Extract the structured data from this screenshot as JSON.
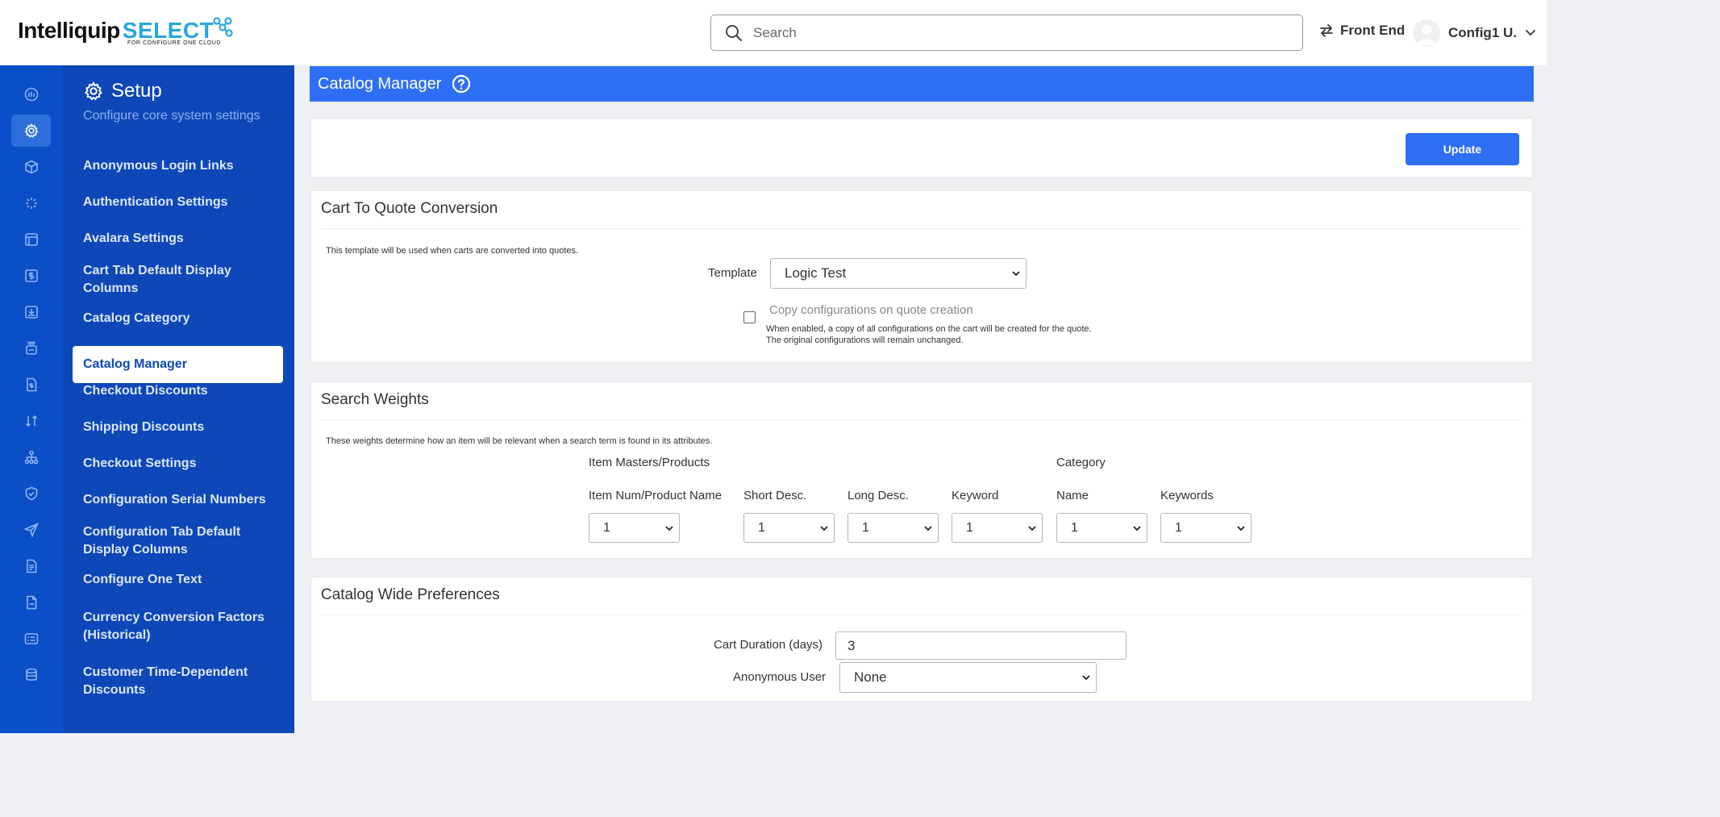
{
  "header": {
    "logo_main": "Intelliquip",
    "logo_select": "SELECT",
    "logo_sub": "FOR CONFIGURE ONE CLOUD",
    "search_placeholder": "Search",
    "front_end": "Front End",
    "user_name": "Config1 U."
  },
  "rail": {
    "icons": [
      "dashboard-icon",
      "gear-icon",
      "cube-icon",
      "loader-icon",
      "layout-icon",
      "dollar-icon",
      "download-icon",
      "stack-icon",
      "file-dollar-icon",
      "arrows-swap-icon",
      "hierarchy-icon",
      "shield-check-icon",
      "send-icon",
      "file-text-icon",
      "file-icon",
      "list-icon",
      "database-icon"
    ],
    "active_index": 1
  },
  "sidebar": {
    "title": "Setup",
    "subtitle": "Configure core system settings",
    "items": [
      {
        "label": "Anonymous Login Links"
      },
      {
        "label": "Authentication Settings"
      },
      {
        "label": "Avalara Settings"
      },
      {
        "label": "Cart Tab Default Display Columns"
      },
      {
        "label": "Catalog Category"
      },
      {
        "label": "Catalog Manager",
        "active": true
      },
      {
        "label": "Checkout Discounts"
      },
      {
        "label": "Shipping Discounts"
      },
      {
        "label": "Checkout Settings"
      },
      {
        "label": "Configuration Serial Numbers"
      },
      {
        "label": "Configuration Tab Default Display Columns"
      },
      {
        "label": "Configure One Text"
      },
      {
        "label": "Currency Conversion Factors (Historical)"
      },
      {
        "label": "Customer Time-Dependent Discounts"
      }
    ]
  },
  "page": {
    "title": "Catalog Manager",
    "update_label": "Update"
  },
  "cart_to_quote": {
    "title": "Cart To Quote Conversion",
    "note": "This template will be used when carts are converted into quotes.",
    "template_label": "Template",
    "template_value": "Logic Test",
    "copy_label": "Copy configurations on quote creation",
    "copy_checked": false,
    "copy_help_1": "When enabled, a copy of all configurations on the cart will be created for the quote.",
    "copy_help_2": "The original configurations will remain unchanged."
  },
  "search_weights": {
    "title": "Search Weights",
    "note": "These weights determine how an item will be relevant when a search term is found in its attributes.",
    "group_items": "Item Masters/Products",
    "group_category": "Category",
    "fields": [
      {
        "label": "Item Num/Product Name",
        "value": "1"
      },
      {
        "label": "Short Desc.",
        "value": "1"
      },
      {
        "label": "Long Desc.",
        "value": "1"
      },
      {
        "label": "Keyword",
        "value": "1"
      },
      {
        "label": "Name",
        "value": "1"
      },
      {
        "label": "Keywords",
        "value": "1"
      }
    ]
  },
  "catalog_prefs": {
    "title": "Catalog Wide Preferences",
    "cart_duration_label": "Cart Duration (days)",
    "cart_duration_value": "3",
    "anon_user_label": "Anonymous User",
    "anon_user_value": "None"
  },
  "colors": {
    "brand_blue": "#2e6ff6",
    "sidebar_blue": "#0d47b8",
    "rail_blue": "#0a4fc7",
    "logo_accent": "#2aa6de"
  }
}
